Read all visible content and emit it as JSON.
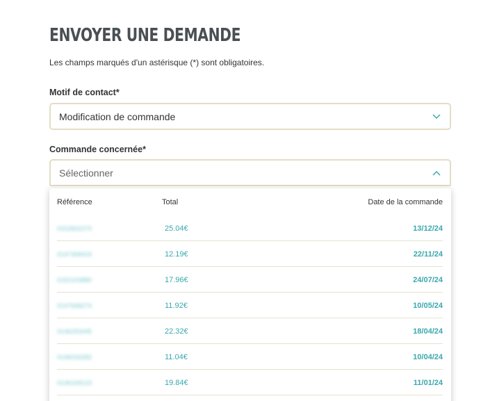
{
  "form": {
    "title": "ENVOYER UNE DEMANDE",
    "intro": "Les champs marqués d'un astérisque (*) sont obligatoires.",
    "motif_label": "Motif de contact*",
    "motif_value": "Modification de commande",
    "commande_label": "Commande concernée*",
    "commande_placeholder": "Sélectionner"
  },
  "colors": {
    "accent": "#3aa8ad",
    "border": "#e3ddc6",
    "title": "#4a4f54"
  },
  "icons": {
    "motif_chevron": "chevron-down-icon",
    "commande_chevron": "chevron-up-icon"
  },
  "dropdown": {
    "headers": {
      "reference": "Référence",
      "total": "Total",
      "date": "Date de la commande"
    },
    "rows": [
      {
        "reference": "0152832270",
        "total": "25.04€",
        "date": "13/12/24"
      },
      {
        "reference": "0147368416",
        "total": "12.19€",
        "date": "22/11/24"
      },
      {
        "reference": "0152103880",
        "total": "17.96€",
        "date": "24/07/24"
      },
      {
        "reference": "0147668274",
        "total": "11.92€",
        "date": "10/05/24"
      },
      {
        "reference": "0146293445",
        "total": "22.32€",
        "date": "18/04/24"
      },
      {
        "reference": "0146026282",
        "total": "11.04€",
        "date": "10/04/24"
      },
      {
        "reference": "0136169123",
        "total": "19.84€",
        "date": "11/01/24"
      }
    ]
  }
}
